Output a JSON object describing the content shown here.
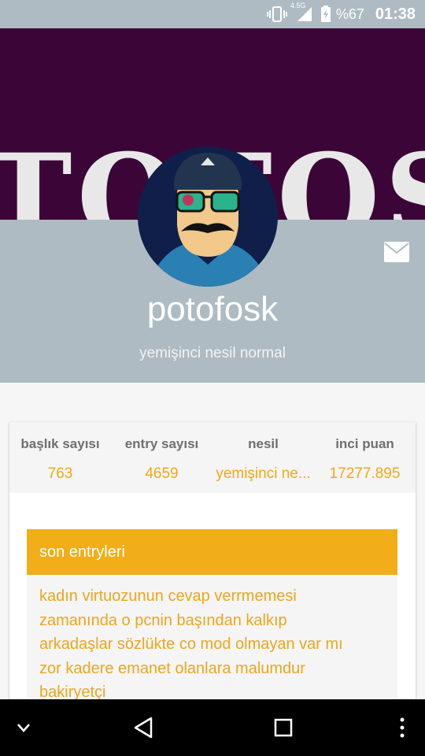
{
  "status_bar": {
    "network_label": "4.5G",
    "battery_percent": "%67",
    "time": "01:38",
    "icons": [
      "vibrate-icon",
      "signal-icon",
      "battery-charging-icon"
    ]
  },
  "profile": {
    "cover_text": "TOTOS",
    "username": "potofosk",
    "generation_title": "yemişinci nesil normal"
  },
  "stats": [
    {
      "label": "başlık sayısı",
      "value": "763"
    },
    {
      "label": "entry sayısı",
      "value": "4659"
    },
    {
      "label": "nesil",
      "value": "yemişinci ne..."
    },
    {
      "label": "inci puan",
      "value": "17277.895"
    }
  ],
  "entries": {
    "header": "son entryleri",
    "items": [
      "kadın virtuozunun cevap verrmemesi",
      "zamanında o pcnin başından kalkıp",
      "arkadaşlar sözlükte co mod olmayan var mı",
      "zor kadere emanet olanlara malumdur",
      "bakiryetçi"
    ]
  },
  "colors": {
    "accent": "#f1ae19",
    "band": "#aebbc2",
    "cover": "#3c0538"
  }
}
